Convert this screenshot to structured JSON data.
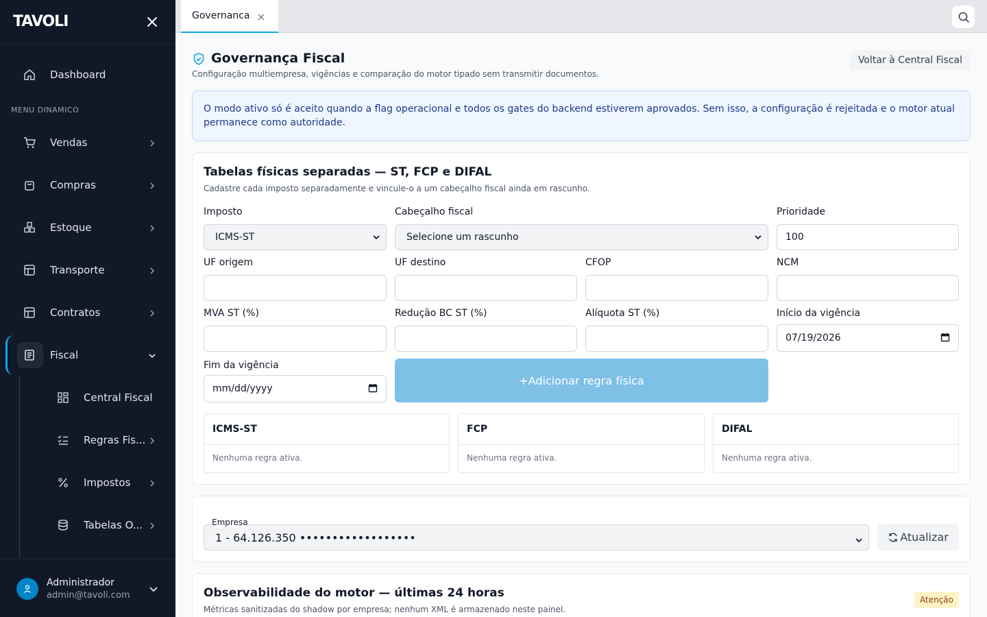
{
  "app": {
    "brand": "TAVOLI"
  },
  "sidebar": {
    "dashboard": "Dashboard",
    "section_label": "MENU DINAMICO",
    "items": {
      "vendas": "Vendas",
      "compras": "Compras",
      "estoque": "Estoque",
      "transporte": "Transporte",
      "contratos": "Contratos",
      "fiscal": "Fiscal"
    },
    "sub_items": {
      "central_fiscal": "Central Fiscal",
      "regras_fiscais": "Regras Fis...",
      "impostos": "Impostos",
      "tabelas": "Tabelas O..."
    },
    "user": {
      "name": "Administrador",
      "email": "admin@tavoli.com"
    }
  },
  "tabs": [
    {
      "label": "Governanca"
    }
  ],
  "page": {
    "title": "Governança Fiscal",
    "subtitle": "Configuração multiempresa, vigências e comparação do motor tipado sem transmitir documentos.",
    "back_button": "Voltar à Central Fiscal",
    "alert": "O modo ativo só é aceito quando a flag operacional e todos os gates do backend estiverem aprovados. Sem isso, a configuração é rejeitada e o motor atual permanece como autoridade."
  },
  "tables_card": {
    "title": "Tabelas físicas separadas — ST, FCP e DIFAL",
    "subtitle": "Cadastre cada imposto separadamente e vincule-o a um cabeçalho fiscal ainda em rascunho.",
    "fields": {
      "imposto": {
        "label": "Imposto",
        "value": "ICMS-ST"
      },
      "cabecalho": {
        "label": "Cabeçalho fiscal",
        "value": "Selecione um rascunho"
      },
      "prioridade": {
        "label": "Prioridade",
        "value": "100"
      },
      "uf_origem": {
        "label": "UF origem",
        "value": ""
      },
      "uf_destino": {
        "label": "UF destino",
        "value": ""
      },
      "cfop": {
        "label": "CFOP",
        "value": ""
      },
      "ncm": {
        "label": "NCM",
        "value": ""
      },
      "mva": {
        "label": "MVA ST (%)",
        "value": ""
      },
      "reducao": {
        "label": "Redução BC ST (%)",
        "value": ""
      },
      "aliquota": {
        "label": "Alíquota ST (%)",
        "value": ""
      },
      "inicio": {
        "label": "Início da vigência",
        "value": "07/19/2026"
      },
      "fim": {
        "label": "Fim da vigência",
        "value": "mm/dd/yyyy"
      }
    },
    "add_button": "+Adicionar regra física",
    "tax_boxes": [
      {
        "title": "ICMS-ST",
        "empty": "Nenhuma regra ativa."
      },
      {
        "title": "FCP",
        "empty": "Nenhuma regra ativa."
      },
      {
        "title": "DIFAL",
        "empty": "Nenhuma regra ativa."
      }
    ]
  },
  "empresa_card": {
    "label": "Empresa",
    "value": "1 - 64.126.350 ••••••••••••••••••",
    "refresh_button": "Atualizar"
  },
  "obs_card": {
    "title": "Observabilidade do motor — últimas 24 horas",
    "subtitle": "Métricas sanitizadas do shadow por empresa; nenhum XML é armazenado neste painel.",
    "badge": "Atenção"
  }
}
